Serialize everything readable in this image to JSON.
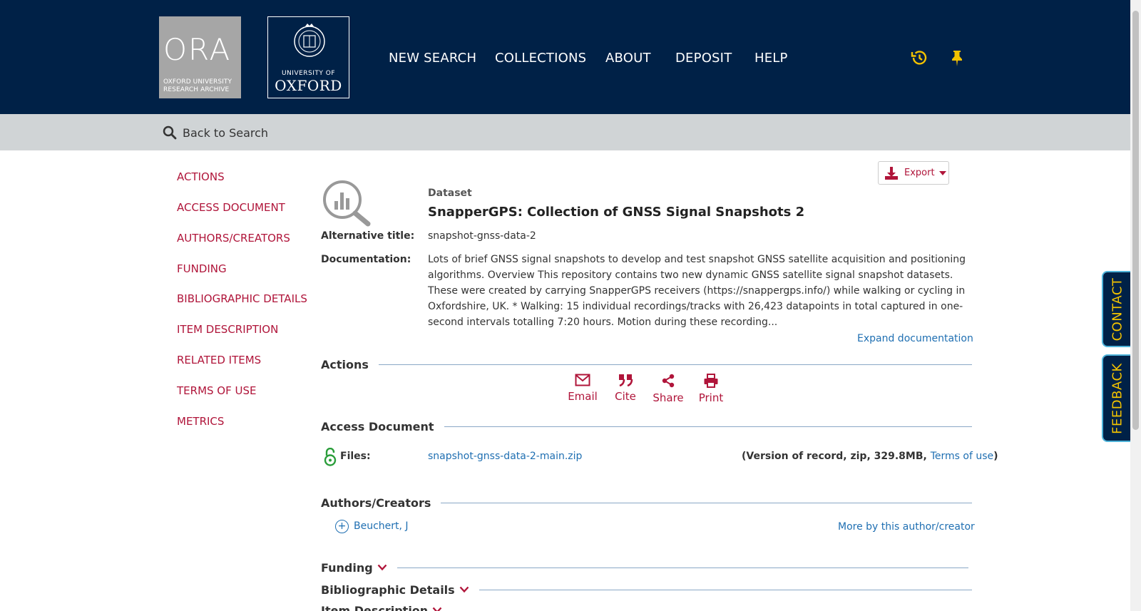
{
  "header": {
    "ora_logo": {
      "big": "ORA",
      "line1": "OXFORD UNIVERSITY",
      "line2": "RESEARCH ARCHIVE"
    },
    "oxford_logo": {
      "line1": "UNIVERSITY OF",
      "line2": "OXFORD"
    },
    "nav": [
      "NEW SEARCH",
      "COLLECTIONS",
      "ABOUT",
      "DEPOSIT",
      "HELP"
    ],
    "icons": [
      "history-icon",
      "pin-icon"
    ]
  },
  "back_bar": {
    "label": "Back to Search"
  },
  "sidenav": [
    "ACTIONS",
    "ACCESS DOCUMENT",
    "AUTHORS/CREATORS",
    "FUNDING",
    "BIBLIOGRAPHIC DETAILS",
    "ITEM DESCRIPTION",
    "RELATED ITEMS",
    "TERMS OF USE",
    "METRICS"
  ],
  "record": {
    "export_label": "Export",
    "type": "Dataset",
    "title": "SnapperGPS: Collection of GNSS Signal Snapshots 2",
    "alt_title_label": "Alternative title:",
    "alt_title": "snapshot-gnss-data-2",
    "doc_label": "Documentation:",
    "documentation": "Lots of brief GNSS signal snapshots to develop and test snapshot GNSS satellite acquisition and positioning algorithms. Overview This repository contains two new dynamic GNSS satellite signal snapshot datasets. These were created by carrying SnapperGPS receivers (https://snappergps.info/) while walking or cycling in Oxfordshire, UK. * Walking: 15 individual recordings/tracks with 26,423 datapoints in total captured in one-second intervals totalling 7:20 hours. Motion during these recording...",
    "expand_label": "Expand documentation"
  },
  "sections": {
    "actions": "Actions",
    "access": "Access Document",
    "authors": "Authors/Creators",
    "funding": "Funding",
    "bibliographic": "Bibliographic Details",
    "item_description": "Item Description"
  },
  "actions": [
    "Email",
    "Cite",
    "Share",
    "Print"
  ],
  "files": {
    "label": "Files:",
    "filename": "snapshot-gnss-data-2-main.zip",
    "meta_prefix": "(Version of record, zip, 329.8MB, ",
    "terms_link": "Terms of use",
    "meta_suffix": ")"
  },
  "authors": {
    "name": "Beuchert, J",
    "more_link": "More by this author/creator"
  },
  "side_tabs": [
    "CONTACT",
    "FEEDBACK"
  ],
  "colors": {
    "navy": "#002147",
    "accent_red": "#b0153a",
    "link_blue": "#1f6fb2",
    "tab_text": "#f3c300"
  }
}
